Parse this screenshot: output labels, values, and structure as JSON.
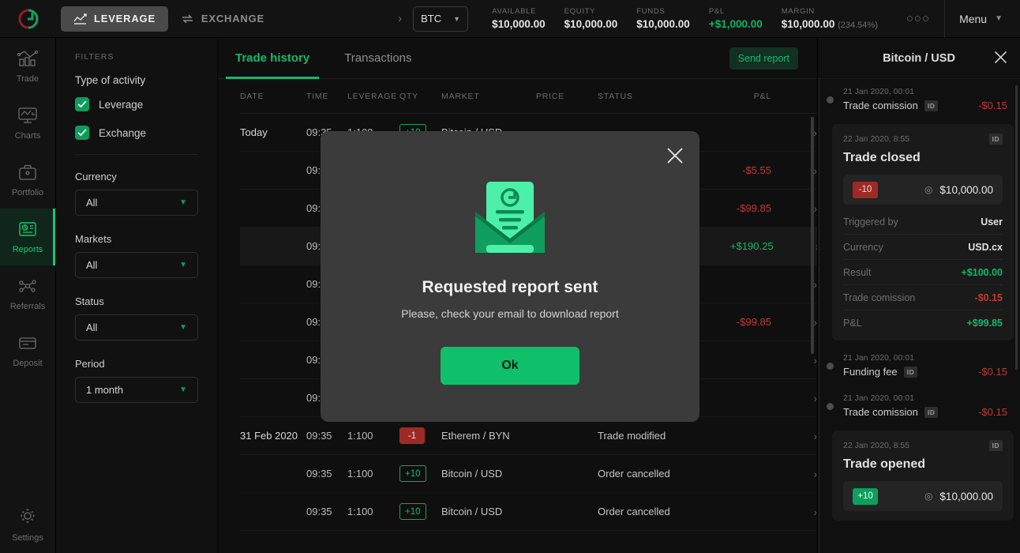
{
  "topbar": {
    "logo": "circle-logo-icon",
    "modes": [
      {
        "label": "LEVERAGE",
        "icon": "trending-up-icon",
        "active": true
      },
      {
        "label": "EXCHANGE",
        "icon": "exchange-arrows-icon",
        "active": false
      }
    ],
    "pair": "BTC",
    "stats": [
      {
        "label": "AVAILABLE",
        "value": "$10,000.00",
        "tone": "normal"
      },
      {
        "label": "EQUITY",
        "value": "$10,000.00",
        "tone": "normal"
      },
      {
        "label": "FUNDS",
        "value": "$10,000.00",
        "tone": "normal"
      },
      {
        "label": "P&L",
        "value": "+$1,000.00",
        "tone": "green"
      },
      {
        "label": "MARGIN",
        "value": "$10,000.00",
        "pct": "(234.54%)",
        "tone": "normal"
      }
    ],
    "more": "○○○",
    "menu": "Menu"
  },
  "sidebar": {
    "items": [
      {
        "label": "Trade",
        "icon": "bar-chart-trend-icon",
        "active": false
      },
      {
        "label": "Charts",
        "icon": "monitor-chart-icon",
        "active": false
      },
      {
        "label": "Portfolio",
        "icon": "briefcase-icon",
        "active": false
      },
      {
        "label": "Reports",
        "icon": "document-report-icon",
        "active": true
      },
      {
        "label": "Referrals",
        "icon": "network-nodes-icon",
        "active": false
      },
      {
        "label": "Deposit",
        "icon": "credit-card-icon",
        "active": false
      }
    ],
    "settings": {
      "label": "Settings",
      "icon": "gear-icon"
    }
  },
  "filters": {
    "title": "FILTERS",
    "activity_heading": "Type of activity",
    "checkboxes": [
      {
        "label": "Leverage",
        "checked": true
      },
      {
        "label": "Exchange",
        "checked": true
      }
    ],
    "selects": [
      {
        "label": "Currency",
        "value": "All"
      },
      {
        "label": "Markets",
        "value": "All"
      },
      {
        "label": "Status",
        "value": "All"
      },
      {
        "label": "Period",
        "value": "1 month"
      }
    ]
  },
  "main": {
    "tabs": [
      {
        "label": "Trade history",
        "active": true
      },
      {
        "label": "Transactions",
        "active": false
      }
    ],
    "send_report": "Send report",
    "columns": [
      "DATE",
      "TIME",
      "LEVERAGE",
      "QTY",
      "MARKET",
      "PRICE",
      "STATUS",
      "P&L"
    ],
    "rows": [
      {
        "date": "Today",
        "time": "09:35",
        "leverage": "1:100",
        "qty": "+10",
        "qty_style": "pos-outline",
        "market": "Bitcoin / USD",
        "price": "",
        "status": "",
        "pl": "",
        "pl_tone": "none"
      },
      {
        "date": "",
        "time": "09:35",
        "leverage": "",
        "qty": "",
        "qty_style": "none",
        "market": "",
        "price": "",
        "status": "",
        "pl": "-$5.55",
        "pl_tone": "neg"
      },
      {
        "date": "",
        "time": "09:35",
        "leverage": "",
        "qty": "",
        "qty_style": "none",
        "market": "",
        "price": "",
        "status": "",
        "pl": "-$99.85",
        "pl_tone": "neg"
      },
      {
        "date": "",
        "time": "09:35",
        "leverage": "",
        "qty": "",
        "qty_style": "none",
        "market": "",
        "price": "",
        "status": "",
        "pl": "+$190.25",
        "pl_tone": "pos",
        "hover": true
      },
      {
        "date": "",
        "time": "09:35",
        "leverage": "",
        "qty": "",
        "qty_style": "none",
        "market": "",
        "price": "",
        "status": "",
        "pl": "",
        "pl_tone": "none"
      },
      {
        "date": "",
        "time": "09:35",
        "leverage": "",
        "qty": "",
        "qty_style": "none",
        "market": "",
        "price": "",
        "status": "",
        "pl": "-$99.85",
        "pl_tone": "neg"
      },
      {
        "date": "",
        "time": "09:35",
        "leverage": "",
        "qty": "",
        "qty_style": "none",
        "market": "",
        "price": "",
        "status": "",
        "pl": "",
        "pl_tone": "none"
      },
      {
        "date": "",
        "time": "09:35",
        "leverage": "",
        "qty": "",
        "qty_style": "none",
        "market": "",
        "price": "",
        "status": "",
        "pl": "",
        "pl_tone": "none"
      },
      {
        "date": "31 Feb 2020",
        "time": "09:35",
        "leverage": "1:100",
        "qty": "-1",
        "qty_style": "neg-solid",
        "market": "Etherem / BYN",
        "price": "",
        "status": "Trade modified",
        "pl": "",
        "pl_tone": "none"
      },
      {
        "date": "",
        "time": "09:35",
        "leverage": "1:100",
        "qty": "+10",
        "qty_style": "pos-outline",
        "market": "Bitcoin / USD",
        "price": "",
        "status": "Order cancelled",
        "pl": "",
        "pl_tone": "none"
      },
      {
        "date": "",
        "time": "09:35",
        "leverage": "1:100",
        "qty": "+10",
        "qty_style": "pos-outline",
        "market": "Bitcoin / USD",
        "price": "",
        "status": "Order cancelled",
        "pl": "",
        "pl_tone": "none"
      }
    ]
  },
  "detail_panel": {
    "title": "Bitcoin / USD",
    "close_icon": "close-icon",
    "events": [
      {
        "kind": "simple",
        "date": "21 Jan 2020, 00:01",
        "name": "Trade comission",
        "id_badge": "ID",
        "amount": "-$0.15",
        "tone": "neg"
      },
      {
        "kind": "card",
        "date": "22 Jan 2020, 8:55",
        "id_badge": "ID",
        "title": "Trade closed",
        "qty": "-10",
        "qty_style": "neg-solid",
        "at_icon": "at-price-icon",
        "price": "$10,000.00",
        "details": [
          {
            "key": "Triggered by",
            "value": "User",
            "tone": "normal"
          },
          {
            "key": "Currency",
            "value": "USD.cx",
            "tone": "normal"
          },
          {
            "key": "Result",
            "value": "+$100.00",
            "tone": "pos"
          },
          {
            "key": "Trade comission",
            "value": "-$0.15",
            "tone": "neg"
          },
          {
            "key": "P&L",
            "value": "+$99.85",
            "tone": "pos"
          }
        ]
      },
      {
        "kind": "simple",
        "date": "21 Jan 2020, 00:01",
        "name": "Funding fee",
        "id_badge": "ID",
        "amount": "-$0.15",
        "tone": "neg"
      },
      {
        "kind": "simple",
        "date": "21 Jan 2020, 00:01",
        "name": "Trade comission",
        "id_badge": "ID",
        "amount": "-$0.15",
        "tone": "neg"
      },
      {
        "kind": "card",
        "date": "22 Jan 2020, 8:55",
        "id_badge": "ID",
        "title": "Trade opened",
        "qty": "+10",
        "qty_style": "pos-solid",
        "at_icon": "at-price-icon",
        "price": "$10,000.00",
        "details": []
      }
    ]
  },
  "modal": {
    "icon": "envelope-report-icon",
    "title": "Requested report sent",
    "subtitle": "Please, check your email to download report",
    "ok_label": "Ok",
    "close_icon": "close-icon"
  },
  "colors": {
    "accent_green": "#13b86e",
    "bright_green": "#0fbf6a",
    "negative_red": "#c0392f",
    "modal_bg": "#3b3b3b"
  }
}
